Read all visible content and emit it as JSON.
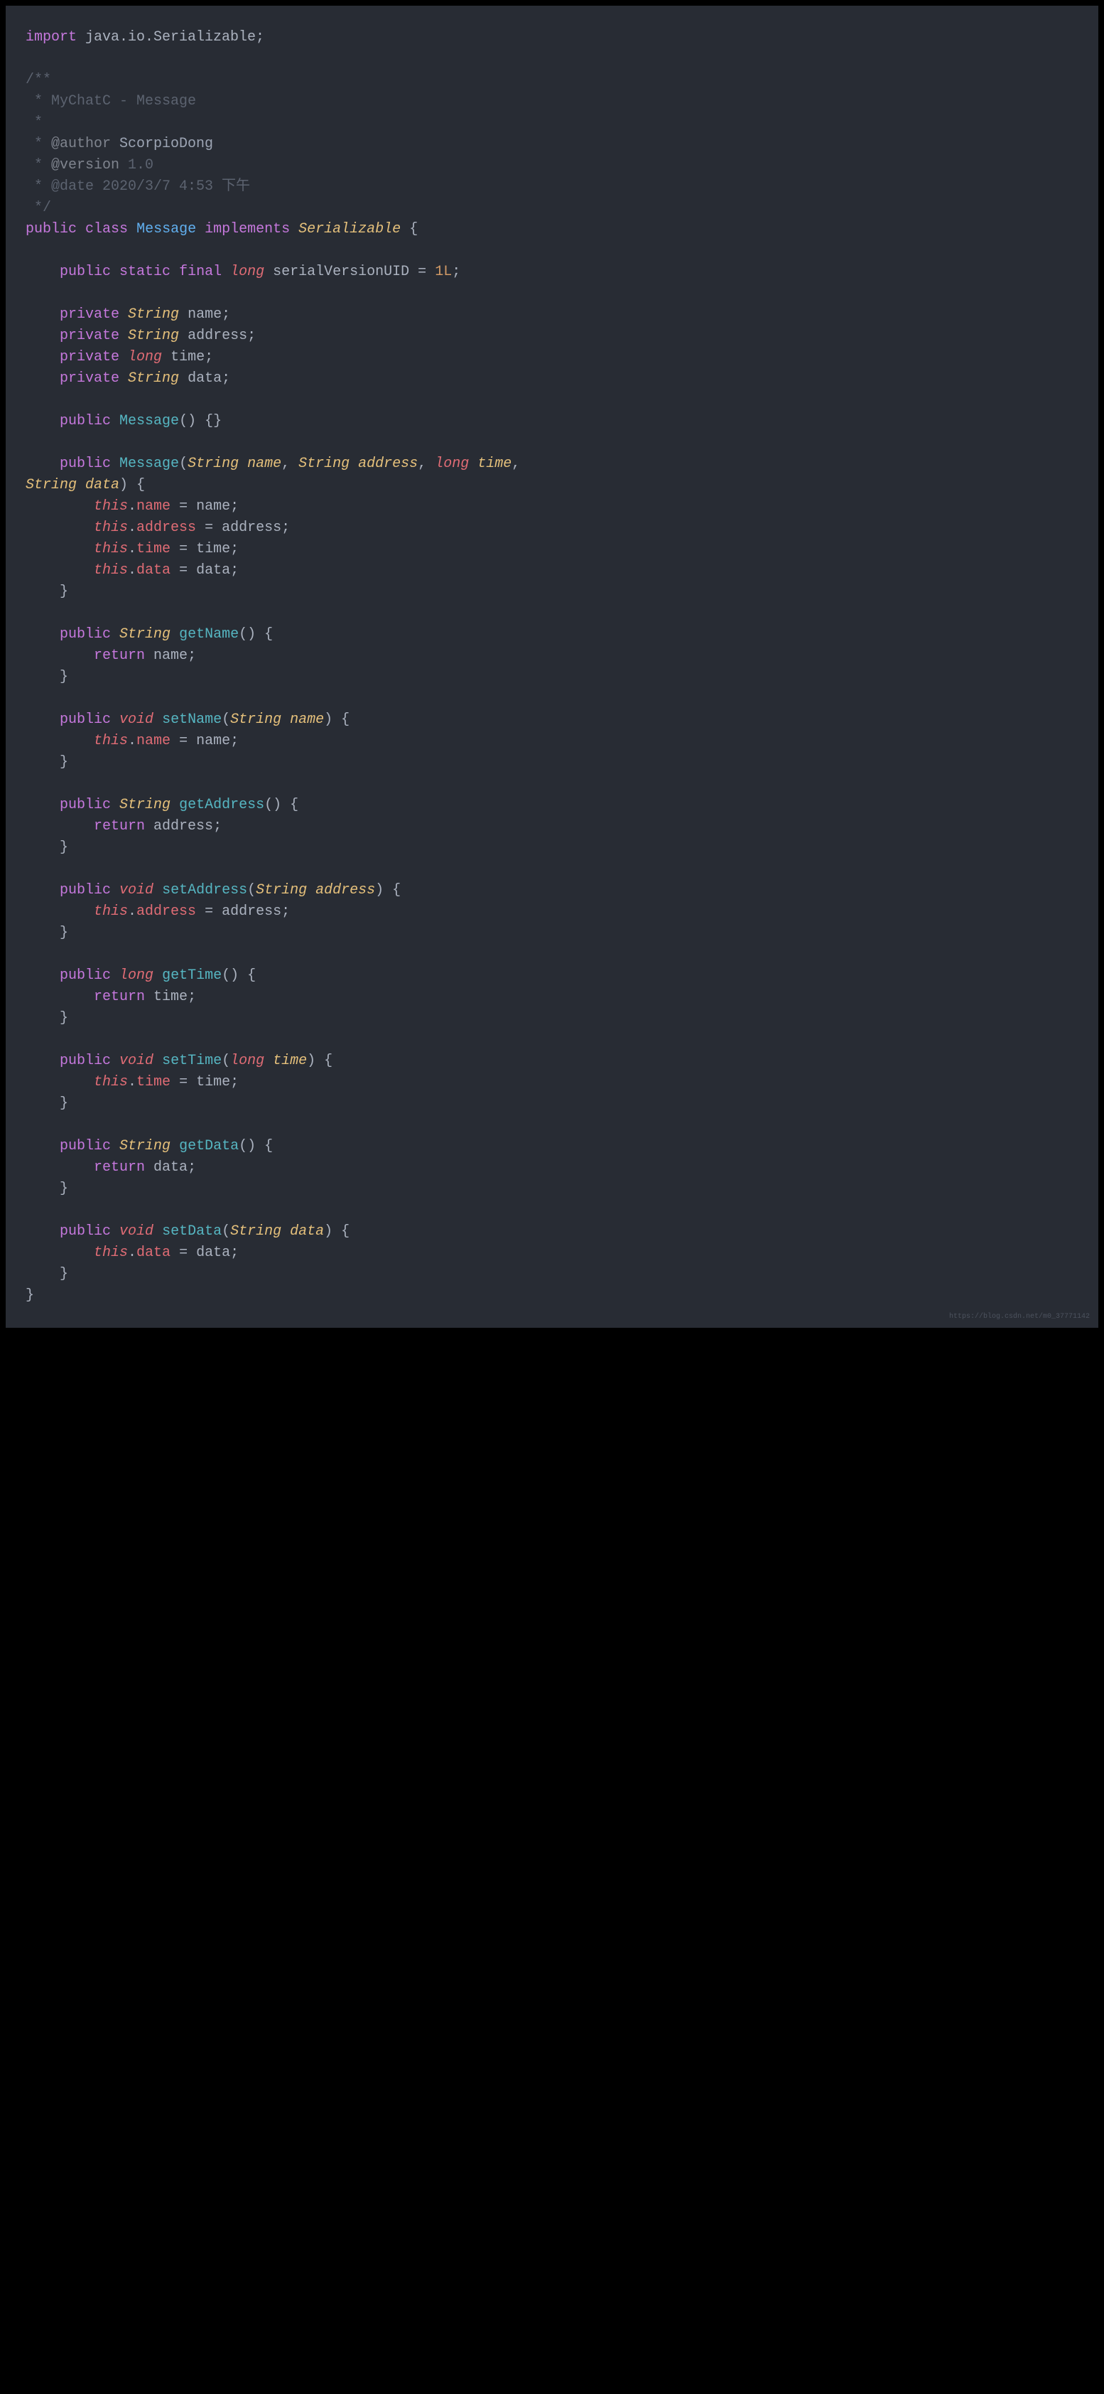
{
  "code": {
    "import_kw": "import",
    "import_pkg": " java.io.Serializable;",
    "doc_open": "/**",
    "doc_l1": " * MyChatC - Message",
    "doc_l2": " *",
    "doc_l3a": " * ",
    "doc_author_tag": "@author",
    "doc_author_name": " ScorpioDong",
    "doc_l4a": " * ",
    "doc_version_tag": "@version",
    "doc_version_val": " 1.0",
    "doc_l5": " * @date 2020/3/7 4:53 下午",
    "doc_close": " */",
    "public": "public",
    "class_kw": "class",
    "class_name": "Message",
    "implements": "implements",
    "serializable": "Serializable",
    "static": "static",
    "final": "final",
    "long": "long",
    "serialVersionUID": "serialVersionUID",
    "eq": " = ",
    "one_l": "1L",
    "private": "private",
    "string": "String",
    "name_field": "name",
    "address_field": "address",
    "time_field": "time",
    "data_field": "data",
    "void": "void",
    "this": "this",
    "return": "return",
    "message_ctor": "Message",
    "getName": "getName",
    "setName": "setName",
    "getAddress": "getAddress",
    "setAddress": "setAddress",
    "getTime": "getTime",
    "setTime": "setTime",
    "getData": "getData",
    "setData": "setData",
    "name_param": "name",
    "address_param": "address",
    "time_param": "time",
    "data_param": "data",
    "watermark": "https://blog.csdn.net/m0_37771142"
  }
}
